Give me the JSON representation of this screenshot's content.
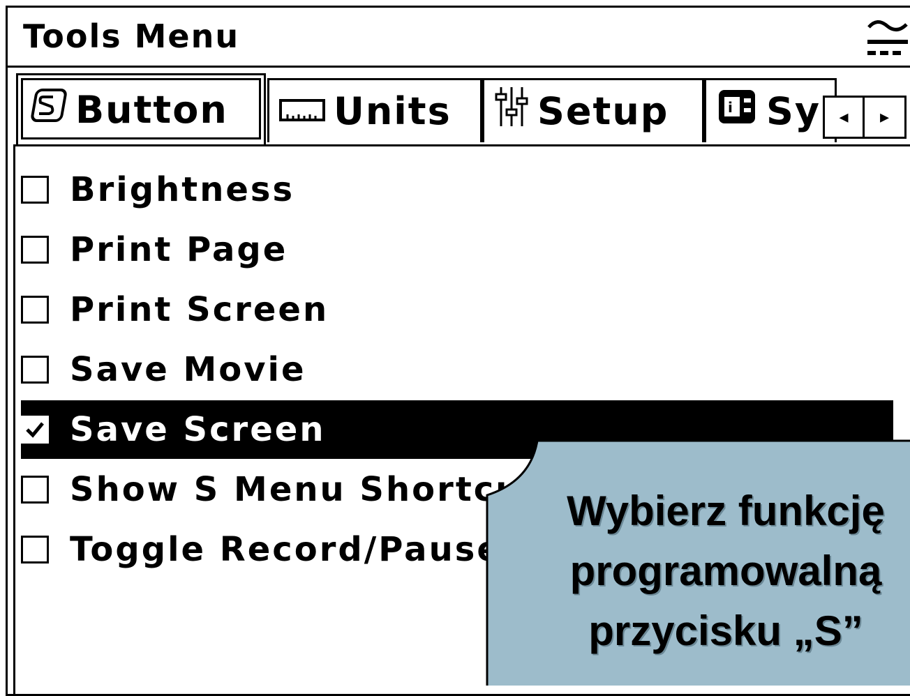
{
  "window": {
    "title": "Tools Menu",
    "title_icon": "connection-signal-icon"
  },
  "tabs": [
    {
      "label": "Button",
      "icon": "s-button-icon",
      "active": true
    },
    {
      "label": "Units",
      "icon": "ruler-icon",
      "active": false
    },
    {
      "label": "Setup",
      "icon": "sliders-icon",
      "active": false
    },
    {
      "label": "Sy",
      "icon": "system-info-icon",
      "active": false
    }
  ],
  "scroll": {
    "left_label": "◂",
    "right_label": "▸"
  },
  "items": [
    {
      "label": "Brightness",
      "checked": false,
      "selected": false
    },
    {
      "label": "Print Page",
      "checked": false,
      "selected": false
    },
    {
      "label": "Print Screen",
      "checked": false,
      "selected": false
    },
    {
      "label": "Save Movie",
      "checked": false,
      "selected": false
    },
    {
      "label": "Save Screen",
      "checked": true,
      "selected": true
    },
    {
      "label": "Show S Menu Shortcut",
      "checked": false,
      "selected": false
    },
    {
      "label": "Toggle Record/Pause",
      "checked": false,
      "selected": false
    }
  ],
  "callout": {
    "line1": "Wybierz funkcję",
    "line2": "programowalną",
    "line3": "przycisku „S”",
    "fill": "#9dbccb"
  }
}
